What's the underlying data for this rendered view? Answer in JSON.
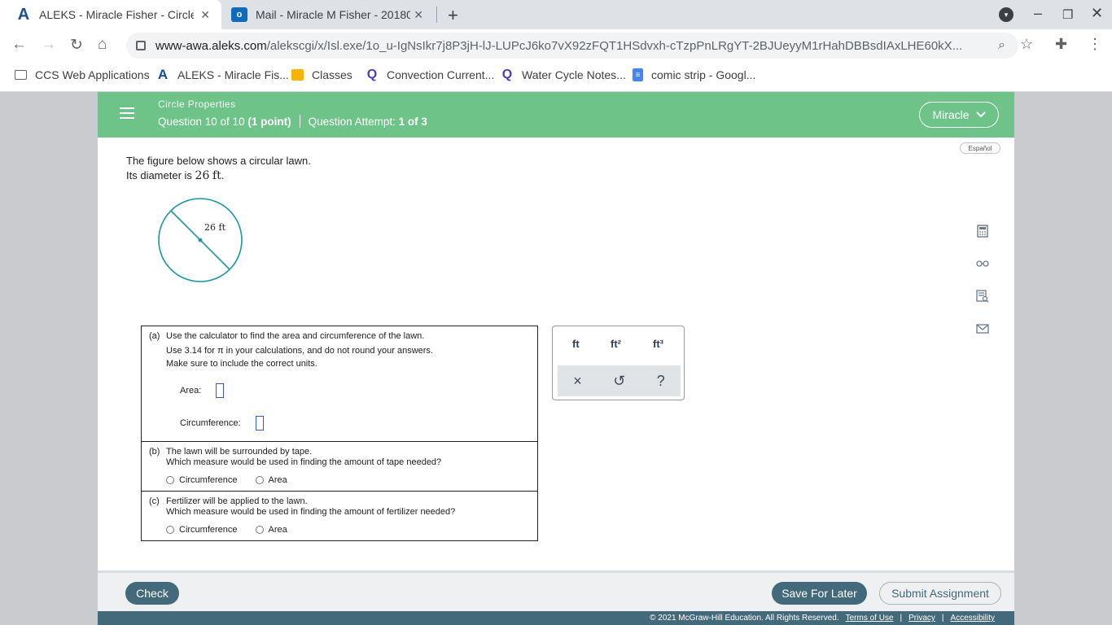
{
  "browser": {
    "tabs": [
      {
        "title": "ALEKS - Miracle Fisher - Circle Properties",
        "favicon": "aleks-icon",
        "active": true
      },
      {
        "title": "Mail - Miracle M Fisher - 20180376",
        "favicon": "outlook-icon",
        "active": false
      }
    ],
    "close_glyph": "✕",
    "newtab_glyph": "+",
    "url_host": "www-awa.aleks.com",
    "url_path": "/alekscgi/x/Isl.exe/1o_u-IgNsIkr7j8P3jH-lJ-LUPcJ6ko7vX92zFQT1HSdvxh-cTzpPnLRgYT-2BJUeyyM1rHahDBBsdIAxLHE60kX...",
    "bookmarks": [
      {
        "label": "CCS Web Applications",
        "icon": "folder-icon"
      },
      {
        "label": "ALEKS - Miracle Fis...",
        "icon": "aleks-icon"
      },
      {
        "label": "Classes",
        "icon": "classroom-icon"
      },
      {
        "label": "Convection Current...",
        "icon": "quizizz-icon"
      },
      {
        "label": "Water Cycle Notes...",
        "icon": "quizizz-icon"
      },
      {
        "label": "comic strip - Googl...",
        "icon": "docs-icon"
      }
    ]
  },
  "header": {
    "topic": "Circle Properties",
    "question_prefix": "Question 10 of 10",
    "points": "(1 point)",
    "attempt_label": "Question Attempt:",
    "attempt_value": "1 of 3",
    "user_name": "Miracle",
    "accent_color": "#6ec388"
  },
  "language_button": "Español",
  "problem": {
    "line1": "The figure below shows a circular lawn.",
    "line2_prefix": "Its diameter is",
    "diameter_value": "26",
    "diameter_unit": "ft",
    "line2_suffix": "."
  },
  "figure": {
    "diameter_label": "26 ft",
    "circle_color": "#1b96a4"
  },
  "part_a": {
    "label": "(a)",
    "lines": [
      "Use the calculator to find the area and circumference of the lawn.",
      "Use 3.14 for π in your calculations, and do not round your answers.",
      "Make sure to include the correct units."
    ],
    "area_label": "Area:",
    "area_value": "",
    "circumference_label": "Circumference:",
    "circumference_value": ""
  },
  "part_b": {
    "label": "(b)",
    "lines": [
      "The lawn will be surrounded by tape.",
      "Which measure would be used in finding the amount of tape needed?"
    ],
    "options": [
      "Circumference",
      "Area"
    ]
  },
  "part_c": {
    "label": "(c)",
    "lines": [
      "Fertilizer will be applied to the lawn.",
      "Which measure would be used in finding the amount of fertilizer needed?"
    ],
    "options": [
      "Circumference",
      "Area"
    ]
  },
  "unit_pad": {
    "units": [
      "ft",
      "ft²",
      "ft³"
    ],
    "actions": [
      {
        "glyph": "×",
        "name": "clear"
      },
      {
        "glyph": "↺",
        "name": "undo"
      },
      {
        "glyph": "?",
        "name": "help"
      }
    ]
  },
  "footer": {
    "check": "Check",
    "save": "Save For Later",
    "submit": "Submit Assignment",
    "copyright": "© 2021 McGraw-Hill Education. All Rights Reserved.",
    "terms": "Terms of Use",
    "privacy": "Privacy",
    "accessibility": "Accessibility",
    "separator": "|"
  }
}
